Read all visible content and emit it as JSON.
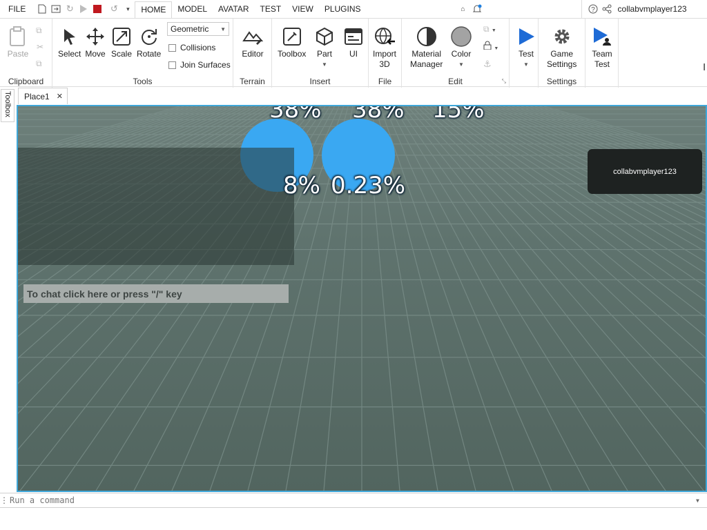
{
  "menu": {
    "file": "FILE",
    "tabs": [
      "HOME",
      "MODEL",
      "AVATAR",
      "TEST",
      "VIEW",
      "PLUGINS"
    ],
    "active_tab": "HOME",
    "username": "collabvmplayer123"
  },
  "ribbon": {
    "clipboard": {
      "title": "Clipboard",
      "paste": "Paste"
    },
    "tools": {
      "title": "Tools",
      "select": "Select",
      "move": "Move",
      "scale": "Scale",
      "rotate": "Rotate",
      "material_value": "Geometric",
      "collisions": "Collisions",
      "join_surfaces": "Join Surfaces"
    },
    "terrain": {
      "title": "Terrain",
      "editor": "Editor"
    },
    "insert": {
      "title": "Insert",
      "toolbox": "Toolbox",
      "part": "Part",
      "ui": "UI"
    },
    "file": {
      "title": "File",
      "import_line1": "Import",
      "import_line2": "3D"
    },
    "edit": {
      "title": "Edit",
      "material_line1": "Material",
      "material_line2": "Manager",
      "color": "Color"
    },
    "test": {
      "label": "Test"
    },
    "settings": {
      "title": "Settings",
      "line1": "Game",
      "line2": "Settings"
    },
    "team_test": {
      "line1": "Team",
      "line2": "Test"
    }
  },
  "sidebar": {
    "toolbox": "Toolbox"
  },
  "document_tab": {
    "label": "Place1",
    "close": "✕"
  },
  "viewport": {
    "top_labels": [
      "38%",
      "38%",
      "15%"
    ],
    "ball_labels": [
      "8%",
      "0.23%"
    ],
    "chat_placeholder": "To chat click here or press \"/\" key",
    "player_name": "collabvmplayer123"
  },
  "command_bar": {
    "placeholder": "Run a command"
  },
  "colors": {
    "accent": "#3fa7d9",
    "ball": "#3aa8f2",
    "test_blue": "#1e6bd6",
    "stop_red": "#c0181f"
  }
}
